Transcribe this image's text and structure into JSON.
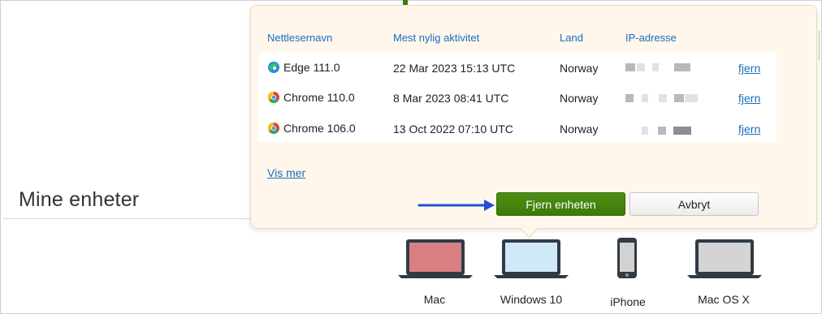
{
  "page": {
    "title": "Mine enheter"
  },
  "popup": {
    "columns": {
      "browser": "Nettlesernavn",
      "activity": "Mest nylig aktivitet",
      "country": "Land",
      "ip": "IP-adresse"
    },
    "rows": [
      {
        "browser": "Edge 111.0",
        "icon": "edge-icon",
        "activity": "22 Mar 2023 15:13 UTC",
        "country": "Norway",
        "action": "fjern"
      },
      {
        "browser": "Chrome 110.0",
        "icon": "chrome-icon",
        "activity": "8 Mar 2023 08:41 UTC",
        "country": "Norway",
        "action": "fjern"
      },
      {
        "browser": "Chrome 106.0",
        "icon": "chrome-icon",
        "activity": "13 Oct 2022 07:10 UTC",
        "country": "Norway",
        "action": "fjern"
      }
    ],
    "show_more": "Vis mer",
    "remove_device_button": "Fjern enheten",
    "cancel_button": "Avbryt"
  },
  "devices": [
    {
      "label": "Mac",
      "icon": "laptop-icon",
      "screen_color": "#d97f82"
    },
    {
      "label": "Windows 10",
      "icon": "laptop-icon",
      "screen_color": "#cfe9f8"
    },
    {
      "label": "iPhone",
      "icon": "phone-icon",
      "screen_color": "#d2d2d2"
    },
    {
      "label": "Mac OS X",
      "icon": "laptop-icon",
      "screen_color": "#d4d4d4"
    }
  ],
  "colors": {
    "accent_green": "#3d7a0a",
    "link_blue": "#1a6cbf",
    "popup_background": "#fff7ec",
    "arrow_blue": "#1f4fd6"
  }
}
